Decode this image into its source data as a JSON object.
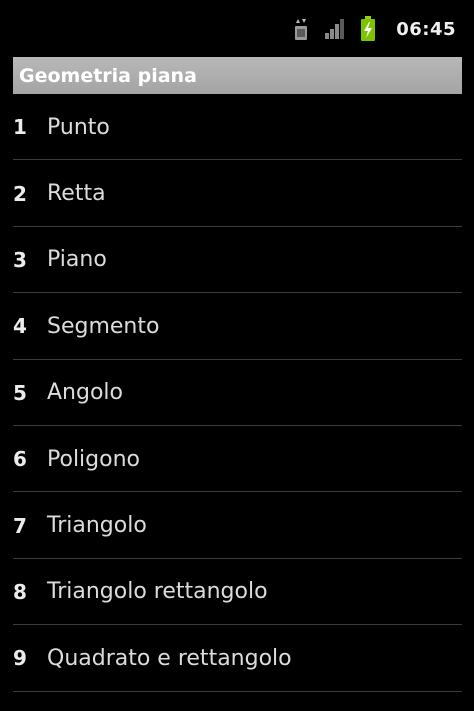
{
  "status_bar": {
    "time": "06:45",
    "icons": [
      "sim-transfer-icon",
      "signal-icon",
      "battery-charging-icon"
    ],
    "battery_color": "#7cc300"
  },
  "header": {
    "title": "Geometria piana"
  },
  "list": {
    "items": [
      {
        "number": "1",
        "label": "Punto"
      },
      {
        "number": "2",
        "label": "Retta"
      },
      {
        "number": "3",
        "label": "Piano"
      },
      {
        "number": "4",
        "label": "Segmento"
      },
      {
        "number": "5",
        "label": "Angolo"
      },
      {
        "number": "6",
        "label": "Poligono"
      },
      {
        "number": "7",
        "label": "Triangolo"
      },
      {
        "number": "8",
        "label": "Triangolo rettangolo"
      },
      {
        "number": "9",
        "label": "Quadrato e rettangolo"
      }
    ]
  }
}
